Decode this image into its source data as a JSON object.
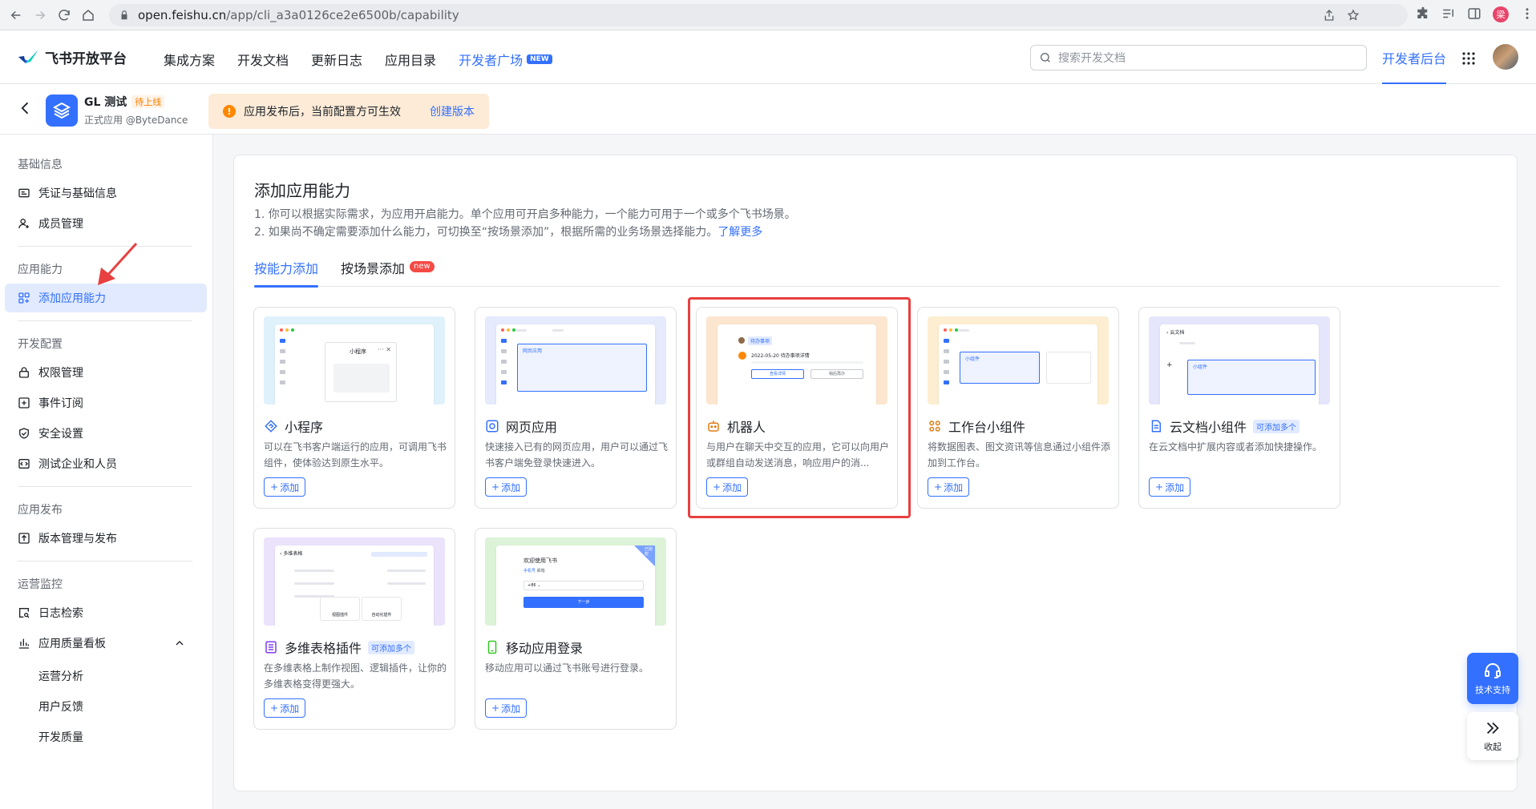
{
  "browser": {
    "url_host": "open.feishu.cn",
    "url_path": "/app/cli_a3a0126ce2e6500b/capability",
    "profile_initial": "梁"
  },
  "header": {
    "brand": "飞书开放平台",
    "nav": [
      "集成方案",
      "开发文档",
      "更新日志",
      "应用目录"
    ],
    "nav_active": "开发者广场",
    "nav_active_badge": "NEW",
    "search_placeholder": "搜索开发文档",
    "dev_backend": "开发者后台"
  },
  "app": {
    "name": "GL 测试",
    "status": "待上线",
    "subtitle": "正式应用 @ByteDance",
    "notice": "应用发布后，当前配置方可生效",
    "notice_link": "创建版本"
  },
  "sidebar": {
    "groups": [
      {
        "title": "基础信息",
        "items": [
          "凭证与基础信息",
          "成员管理"
        ]
      },
      {
        "title": "应用能力",
        "items": [
          "添加应用能力"
        ]
      },
      {
        "title": "开发配置",
        "items": [
          "权限管理",
          "事件订阅",
          "安全设置",
          "测试企业和人员"
        ]
      },
      {
        "title": "应用发布",
        "items": [
          "版本管理与发布"
        ]
      },
      {
        "title": "运营监控",
        "items": [
          "日志检索",
          "应用质量看板"
        ],
        "subitems": [
          "运营分析",
          "用户反馈",
          "开发质量"
        ]
      }
    ]
  },
  "main": {
    "title": "添加应用能力",
    "desc1": "1. 你可以根据实际需求，为应用开启能力。单个应用可开启多种能力，一个能力可用于一个或多个飞书场景。",
    "desc2": "2. 如果尚不确定需要添加什么能力，可切换至“按场景添加”，根据所需的业务场景选择能力。",
    "desc2_link": "了解更多",
    "tabs": [
      {
        "label": "按能力添加",
        "active": true
      },
      {
        "label": "按场景添加",
        "badge": "new"
      }
    ],
    "add_label": "添加",
    "cards": [
      {
        "title": "小程序",
        "desc": "可以在飞书客户端运行的应用，可调用飞书组件，使体验达到原生水平。",
        "preview_text": "小程序",
        "icon": "mini-program-icon",
        "color": "#3370ff"
      },
      {
        "title": "网页应用",
        "desc": "快速接入已有的网页应用，用户可以通过飞书客户端免登录快速进入。",
        "preview_text": "网页应用",
        "icon": "web-app-icon",
        "color": "#3370ff"
      },
      {
        "title": "机器人",
        "desc": "与用户在聊天中交互的应用，它可以向用户或群组自动发送消息，响应用户的消...",
        "preview_text": "2022-05-20 待办事项详情",
        "preview_tag": "待办事项",
        "preview_btn1": "查看详情",
        "preview_btn2": "稍后再办",
        "icon": "robot-icon",
        "color": "#e07b16"
      },
      {
        "title": "工作台小组件",
        "desc": "将数据图表、图文资讯等信息通过小组件添加到工作台。",
        "preview_text": "小组件",
        "icon": "widget-icon",
        "color": "#e07b16"
      },
      {
        "title": "云文档小组件",
        "tag": "可添加多个",
        "desc": "在云文档中扩展内容或者添加快捷操作。",
        "preview_text": "小组件",
        "preview_header": "云文档",
        "icon": "doc-widget-icon",
        "color": "#3370ff"
      },
      {
        "title": "多维表格插件",
        "tag": "可添加多个",
        "desc": "在多维表格上制作视图、逻辑插件，让你的多维表格变得更强大。",
        "preview_text": "多维表格",
        "preview_chip1": "视图插件",
        "preview_chip2": "自动化插件",
        "icon": "bitable-icon",
        "color": "#7f3bf5"
      },
      {
        "title": "移动应用登录",
        "desc": "移动应用可以通过飞书账号进行登录。",
        "preview_text": "欢迎使用飞书",
        "preview_tab": "手机号",
        "preview_tab2": "邮箱",
        "preview_code": "+86",
        "preview_btn": "下一步",
        "preview_corner": "已授权",
        "icon": "mobile-login-icon",
        "color": "#34c724"
      }
    ]
  },
  "floating": {
    "support": "技术支持",
    "collapse": "收起"
  }
}
